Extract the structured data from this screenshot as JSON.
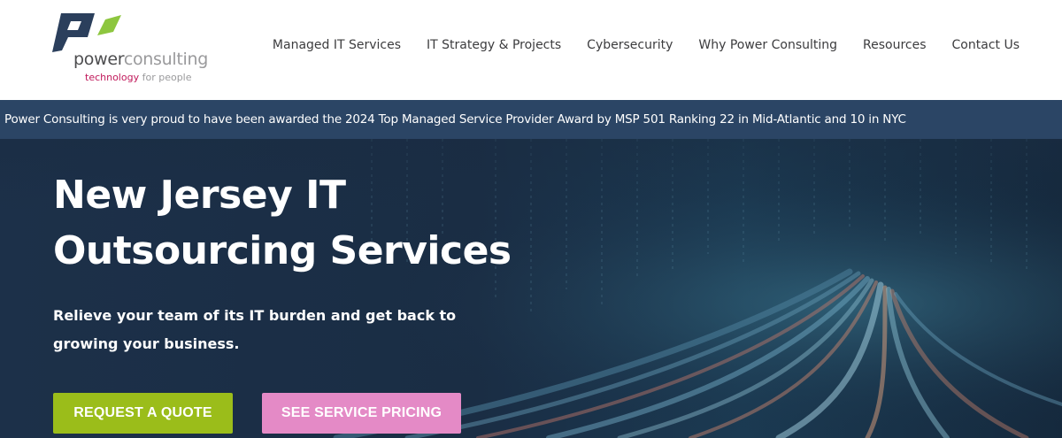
{
  "brand": {
    "wordmark_part1": "power",
    "wordmark_part2": "consulting",
    "tagline_part1": "technology",
    "tagline_part2": "for people",
    "colors": {
      "mark_dark": "#2b3f5c",
      "mark_green": "#8dc63f",
      "tagline_accent": "#c0185a"
    }
  },
  "nav": {
    "items": [
      {
        "label": "Managed IT Services"
      },
      {
        "label": "IT Strategy & Projects"
      },
      {
        "label": "Cybersecurity"
      },
      {
        "label": "Why Power Consulting"
      },
      {
        "label": "Resources"
      },
      {
        "label": "Contact Us"
      }
    ]
  },
  "announcement": {
    "text": "Power Consulting is very proud to have been awarded the 2024 Top Managed Service Provider Award by MSP 501 Ranking 22 in Mid-Atlantic and 10 in NYC",
    "background": "#2b4565"
  },
  "hero": {
    "title_line1": "New Jersey IT",
    "title_line2": "Outsourcing Services",
    "subtitle": "Relieve your team of its IT burden and get back to growing your business.",
    "background_icon": "data-highway-image",
    "primary_button": {
      "label": "REQUEST A QUOTE",
      "color": "#9bbd1a"
    },
    "secondary_button": {
      "label": "SEE SERVICE PRICING",
      "color": "#e48ac6"
    }
  }
}
